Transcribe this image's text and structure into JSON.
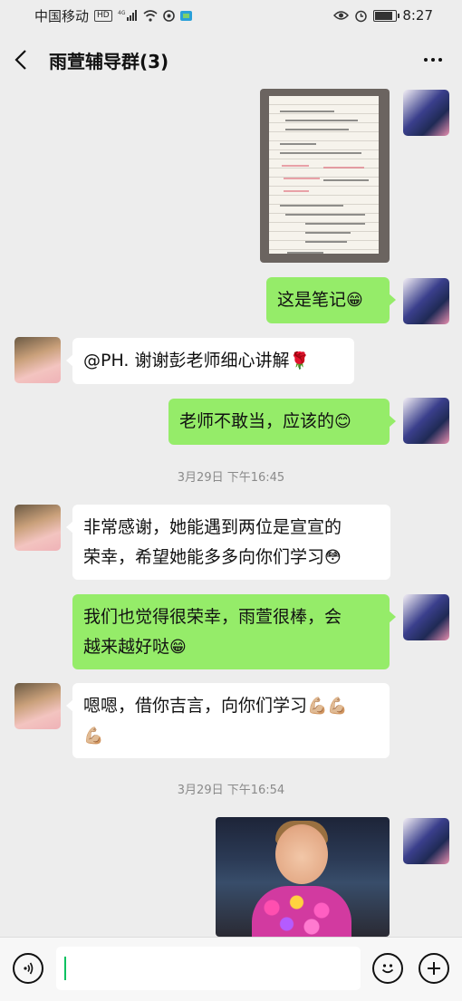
{
  "status_bar": {
    "carrier": "中国移动",
    "hd": "HD",
    "network": "4G",
    "time": "8:27",
    "battery_level": 0.85
  },
  "header": {
    "title": "雨萱辅导群(3)",
    "back_icon": "chevron-left-icon",
    "more_icon": "more-dots-icon"
  },
  "messages": [
    {
      "type": "image",
      "from": "me",
      "content": "notebook-photo"
    },
    {
      "type": "text",
      "from": "me",
      "text": "这是笔记",
      "emoji": "😁"
    },
    {
      "type": "text",
      "from": "other",
      "text": "@PH.  谢谢彭老师细心讲解",
      "emoji": "🌹"
    },
    {
      "type": "text",
      "from": "me",
      "text": "老师不敢当，应该的",
      "emoji": "😊"
    },
    {
      "type": "timestamp",
      "text": "3月29日 下午16:45"
    },
    {
      "type": "text",
      "from": "other",
      "line1": "非常感谢，她能遇到两位是宣宣的",
      "line2": "荣幸，希望她能多多向你们学习",
      "emoji": "😳"
    },
    {
      "type": "text",
      "from": "me",
      "line1": "我们也觉得很荣幸，雨萱很棒，会",
      "line2": "越来越好哒",
      "emoji": "😁"
    },
    {
      "type": "text",
      "from": "other",
      "line1": "嗯嗯，借你吉言，向你们学习",
      "emoji_line1": "💪🏼💪🏼",
      "emoji_line2": "💪🏼"
    },
    {
      "type": "timestamp",
      "text": "3月29日 下午16:54"
    },
    {
      "type": "image",
      "from": "me",
      "content": "child-photo"
    }
  ],
  "input_bar": {
    "voice_icon": "voice-icon",
    "emoji_icon": "emoji-icon",
    "plus_icon": "plus-icon",
    "value": ""
  },
  "colors": {
    "background": "#ededed",
    "my_bubble": "#95ec69",
    "their_bubble": "#ffffff",
    "caret": "#07c160"
  }
}
